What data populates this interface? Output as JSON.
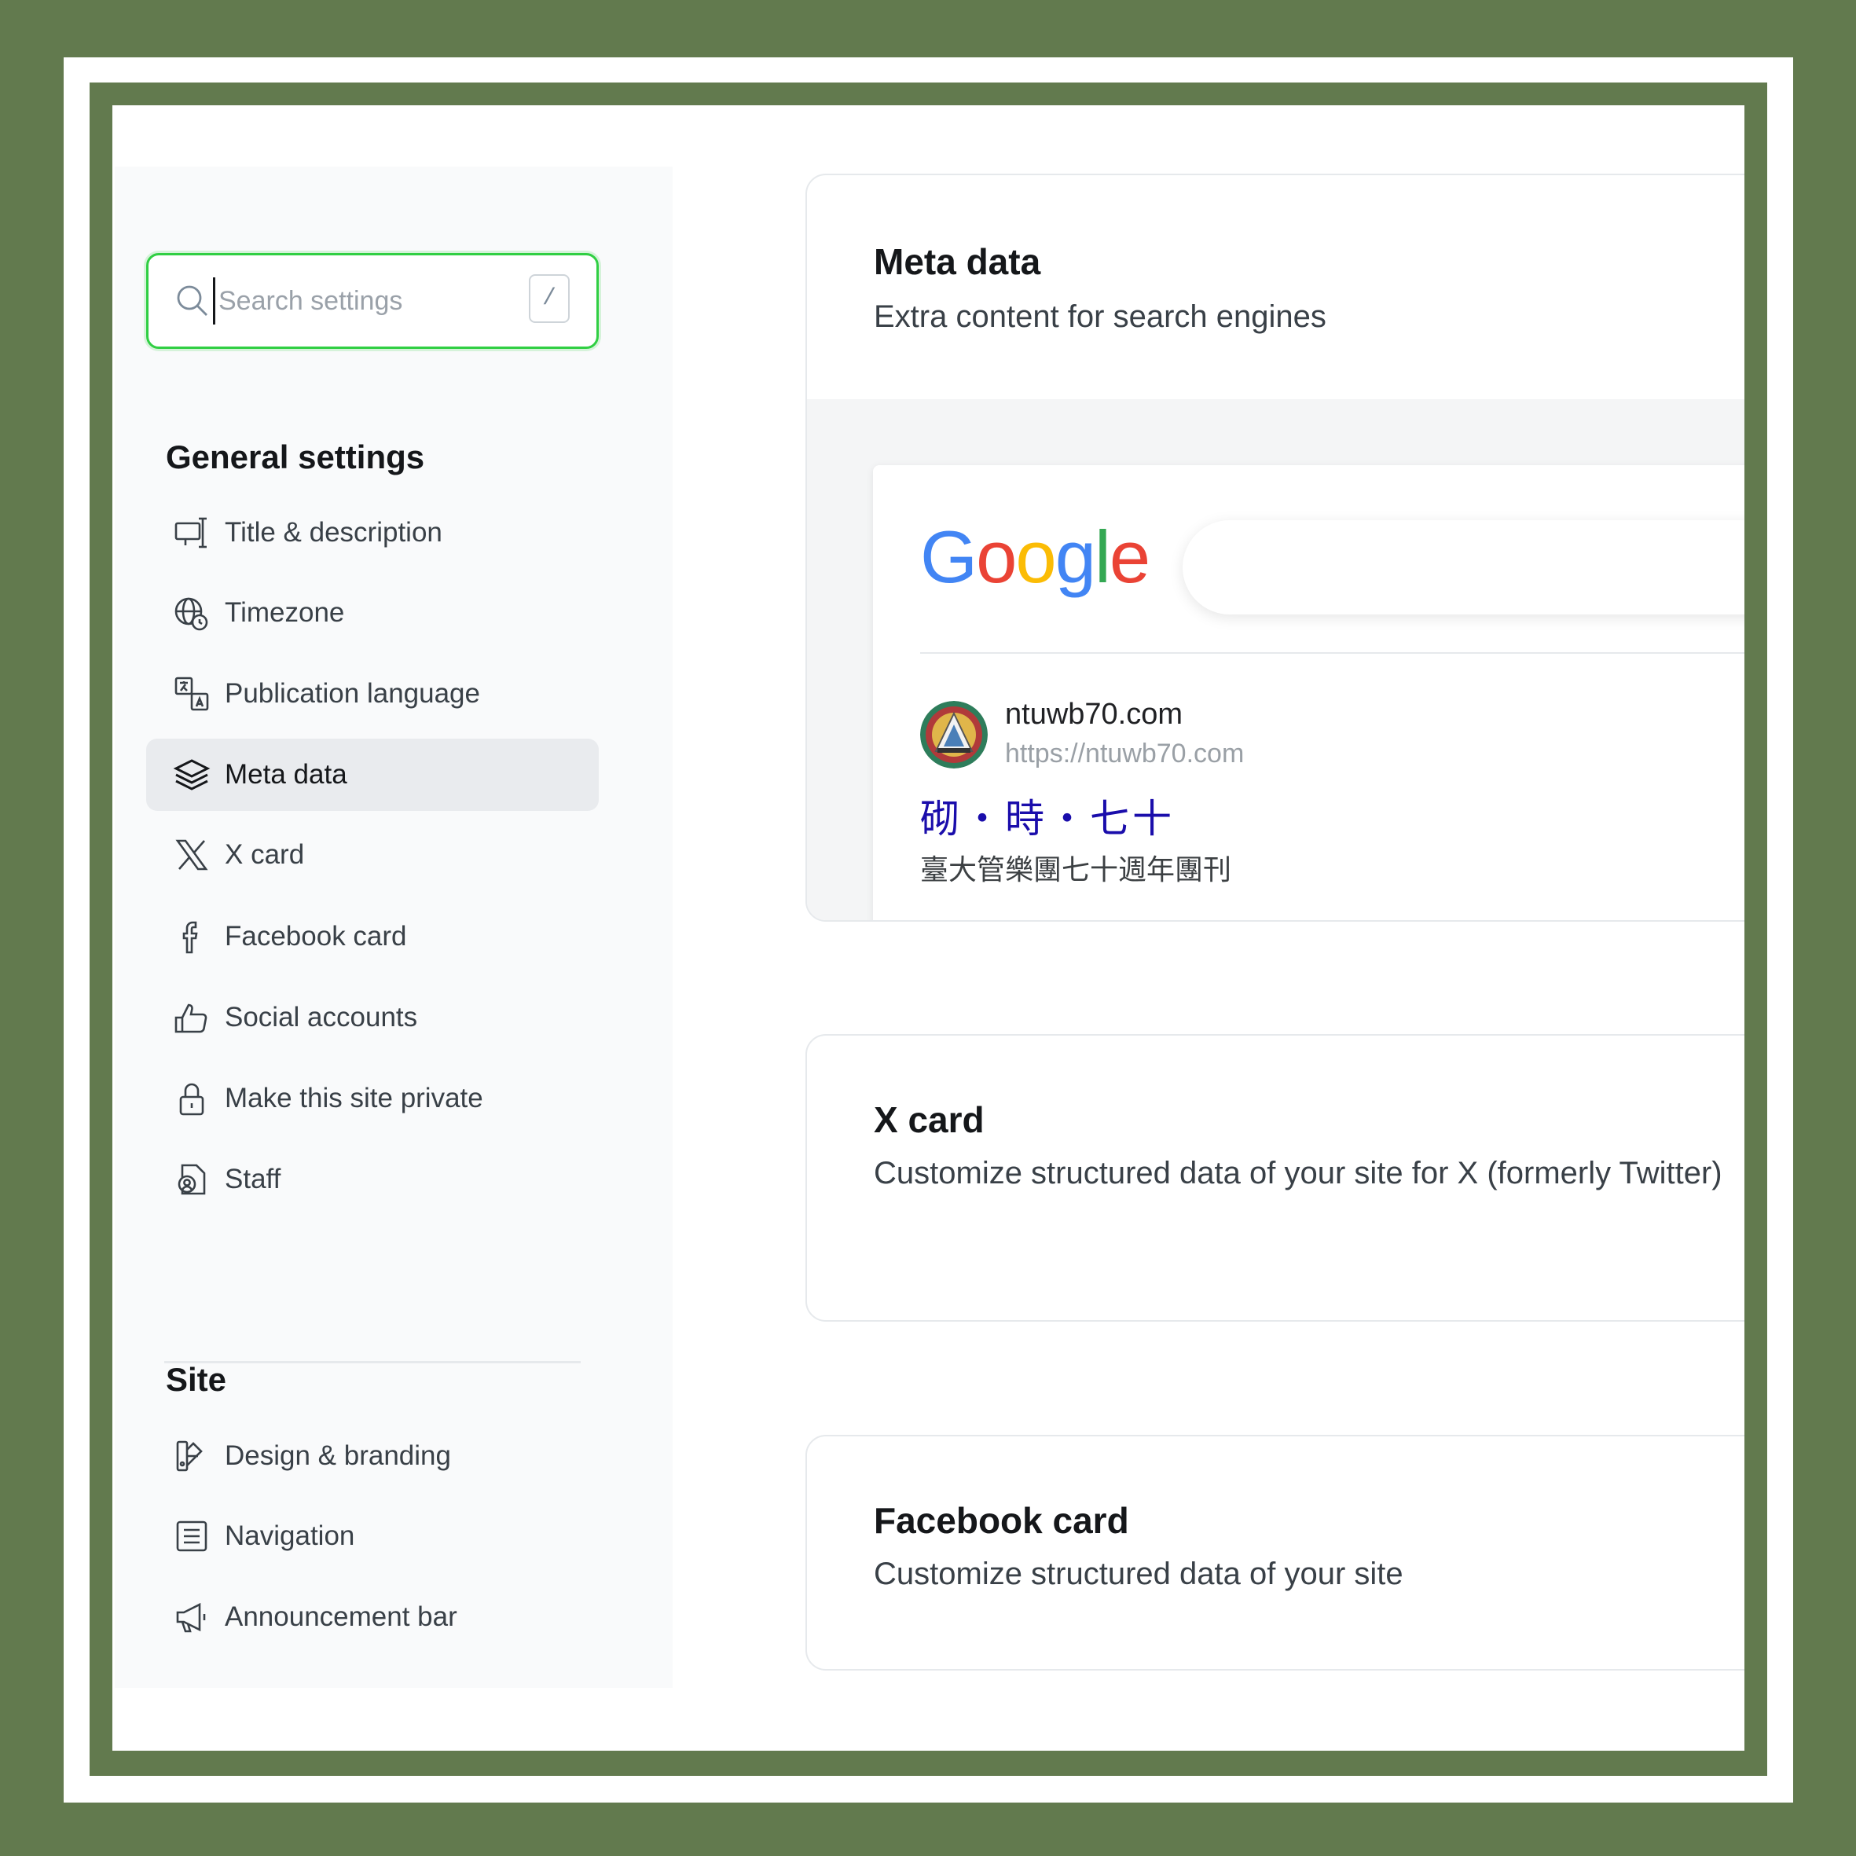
{
  "sidebar": {
    "search": {
      "placeholder": "Search settings",
      "shortcut": "/"
    },
    "general_title": "General settings",
    "general_items": [
      {
        "label": "Title & description",
        "icon": "title-description-icon"
      },
      {
        "label": "Timezone",
        "icon": "globe-clock-icon"
      },
      {
        "label": "Publication language",
        "icon": "translate-icon"
      },
      {
        "label": "Meta data",
        "icon": "layers-icon",
        "active": true
      },
      {
        "label": "X card",
        "icon": "x-logo-icon"
      },
      {
        "label": "Facebook card",
        "icon": "facebook-icon"
      },
      {
        "label": "Social accounts",
        "icon": "thumbs-up-icon"
      },
      {
        "label": "Make this site private",
        "icon": "lock-icon"
      },
      {
        "label": "Staff",
        "icon": "staff-icon"
      }
    ],
    "site_title": "Site",
    "site_items": [
      {
        "label": "Design & branding",
        "icon": "design-branding-icon"
      },
      {
        "label": "Navigation",
        "icon": "navigation-icon"
      },
      {
        "label": "Announcement bar",
        "icon": "megaphone-icon"
      }
    ]
  },
  "meta_card": {
    "title": "Meta data",
    "description": "Extra content for search engines",
    "preview": {
      "engine_logo": "Google",
      "site_name": "ntuwb70.com",
      "site_url": "https://ntuwb70.com",
      "result_title": "砌・時・七十",
      "result_description": "臺大管樂團七十週年團刊"
    }
  },
  "x_card": {
    "title": "X card",
    "description": "Customize structured data of your site for X (formerly Twitter)"
  },
  "facebook_card": {
    "title": "Facebook card",
    "description": "Customize structured data of your site"
  },
  "colors": {
    "frame_green": "#627a4e",
    "search_focus": "#30cf43",
    "sidebar_bg": "#f9fafb",
    "active_item_bg": "#e9ebee",
    "serp_link": "#1a0dab"
  }
}
